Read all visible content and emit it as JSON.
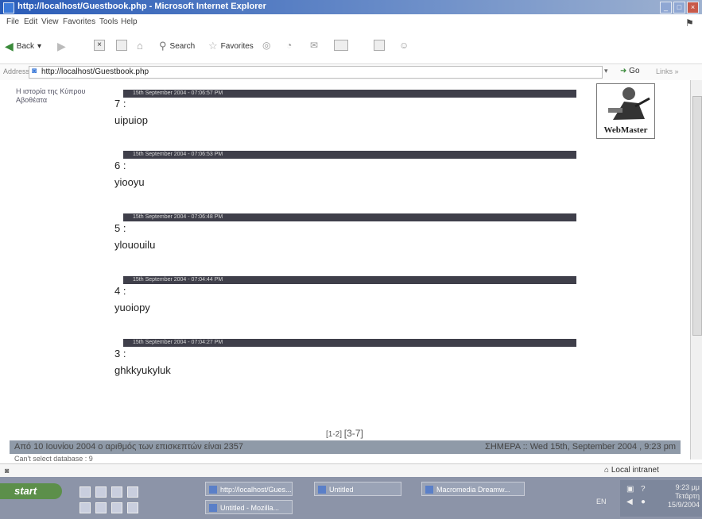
{
  "window": {
    "title": "http://localhost/Guestbook.php - Microsoft Internet Explorer"
  },
  "menu": [
    "File",
    "Edit",
    "View",
    "Favorites",
    "Tools",
    "Help"
  ],
  "toolbar": {
    "back": "Back",
    "search": "Search",
    "favorites": "Favorites"
  },
  "address": {
    "label": "Address",
    "url": "http://localhost/Guestbook.php",
    "go": "Go",
    "links": "Links"
  },
  "sidebar": {
    "link_text": "Η ιστορία της Κύπρου Αβοθέατα"
  },
  "badge": {
    "label": "WebMaster"
  },
  "entries": [
    {
      "date": "15th September 2004 - 07:06:57 PM",
      "num": "7 :",
      "text": "uipuiop"
    },
    {
      "date": "15th September 2004 - 07:06:53 PM",
      "num": "6 :",
      "text": "yiooyu"
    },
    {
      "date": "15th September 2004 - 07:06:48 PM",
      "num": "5 :",
      "text": "ylououilu"
    },
    {
      "date": "15th September 2004 - 07:04:44 PM",
      "num": "4 :",
      "text": "yuoiopy"
    },
    {
      "date": "15th September 2004 - 07:04:27 PM",
      "num": "3 :",
      "text": "ghkkyukyluk"
    }
  ],
  "pager": {
    "prev": "[1-2]",
    "current": "[3-7]"
  },
  "footer": {
    "left": "Από 10 Ιουνίου 2004 ο αριθμός των επισκεπτών είναι 2357",
    "right": "ΣΗΜΕΡΑ :: Wed 15th, September 2004 , 9:23 pm"
  },
  "db_error": "Can't select database : 9",
  "status": {
    "zone": "Local intranet"
  },
  "taskbar": {
    "start": "start",
    "tasks": [
      "http://localhost/Gues...",
      "Untitled - Mozilla...",
      "Untitled",
      "Macromedia Dreamw..."
    ],
    "lang": "EN",
    "time": "9:23 μμ",
    "day": "Τετάρτη",
    "date": "15/9/2004"
  }
}
